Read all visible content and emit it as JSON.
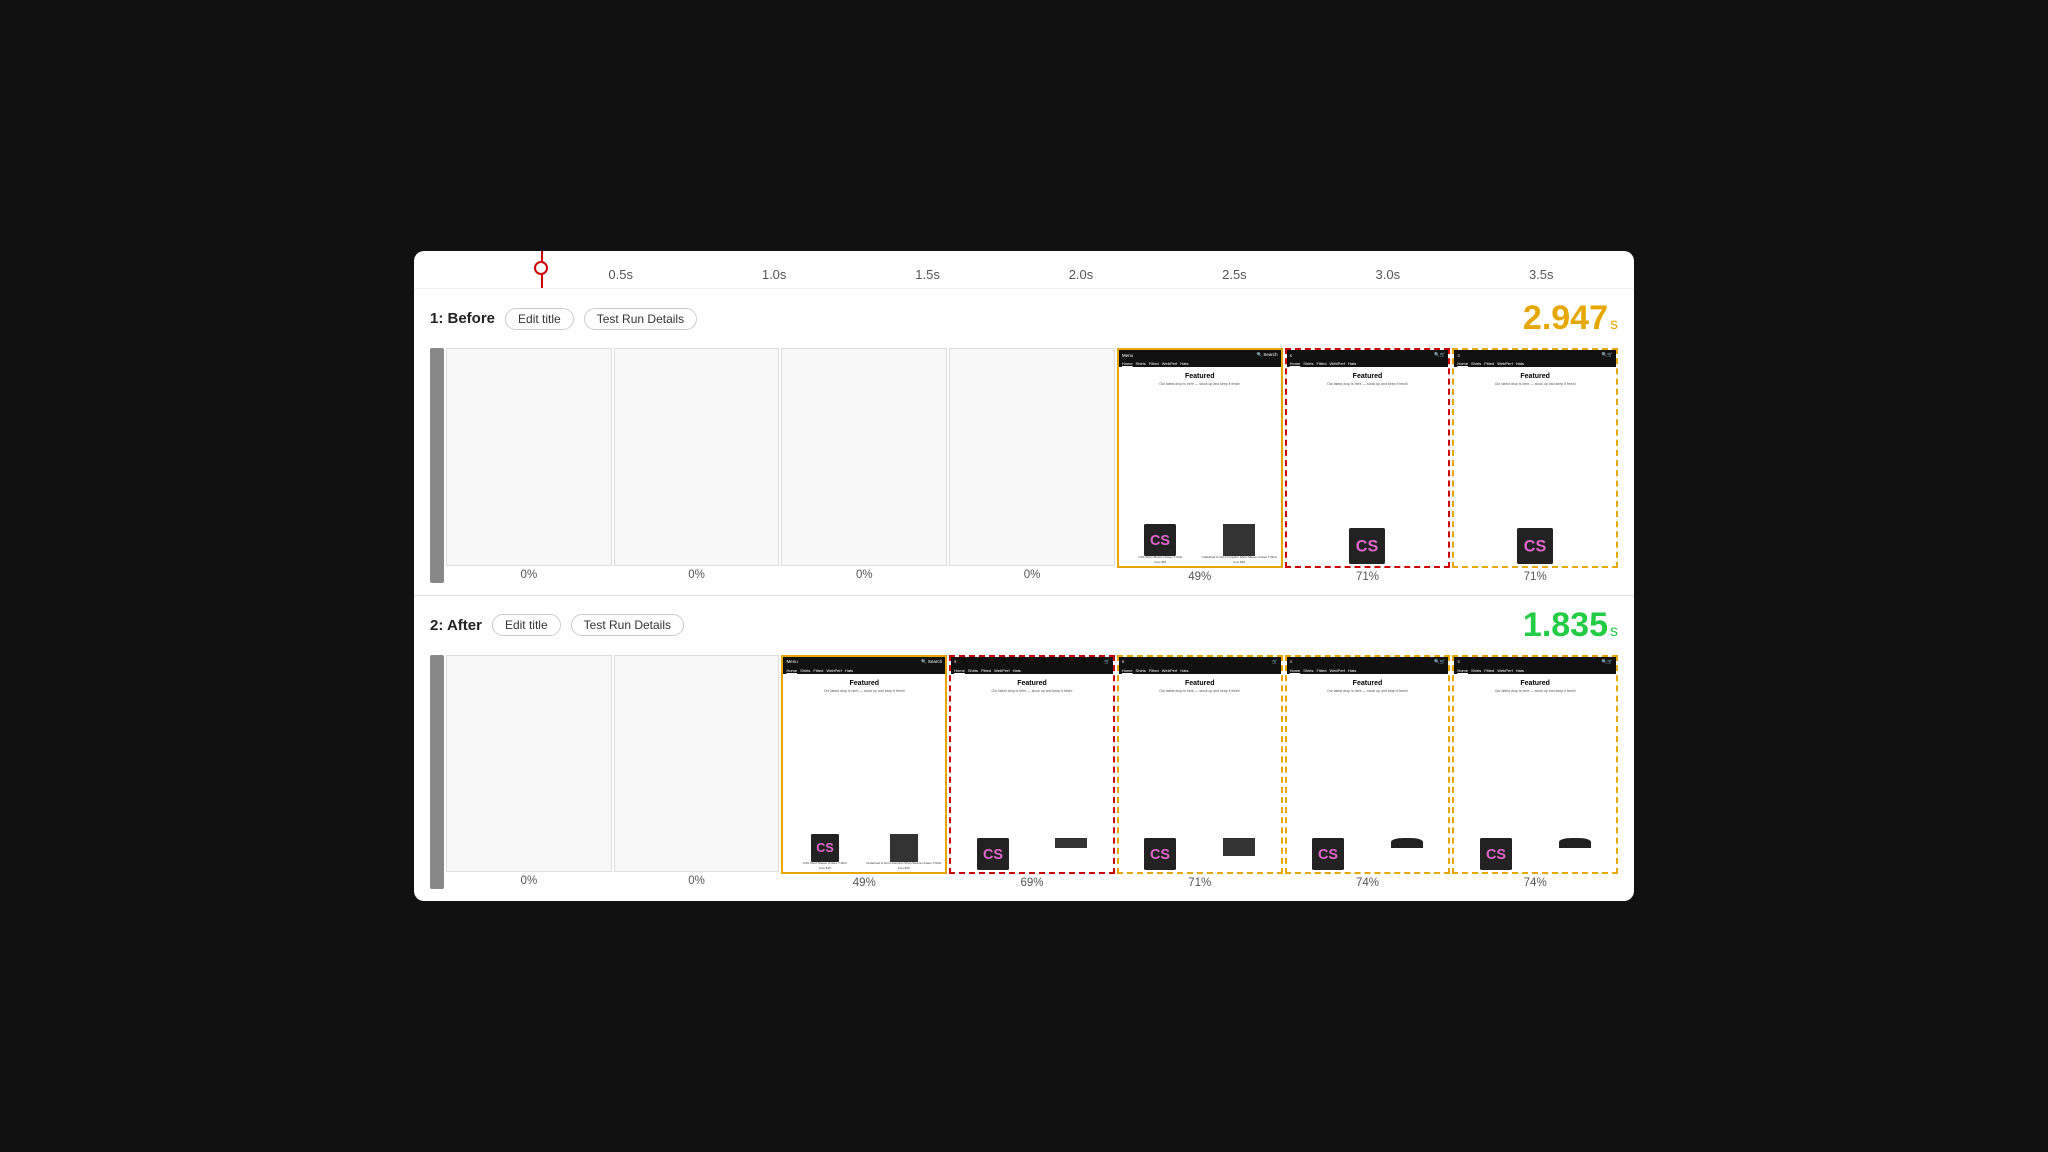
{
  "timeline": {
    "markers": [
      "0.5s",
      "1.0s",
      "1.5s",
      "2.0s",
      "2.5s",
      "3.0s",
      "3.5s"
    ]
  },
  "before": {
    "label": "1: Before",
    "edit_title_label": "Edit title",
    "test_run_label": "Test Run Details",
    "score": "2.947",
    "score_unit": "s",
    "frames": [
      {
        "pct": "0%",
        "type": "empty"
      },
      {
        "pct": "0%",
        "type": "empty"
      },
      {
        "pct": "0%",
        "type": "empty"
      },
      {
        "pct": "0%",
        "type": "empty"
      },
      {
        "pct": "49%",
        "type": "content",
        "border": "orange"
      },
      {
        "pct": "71%",
        "type": "content",
        "border": "red-dashed"
      },
      {
        "pct": "71%",
        "type": "content",
        "border": "orange-dashed"
      }
    ]
  },
  "after": {
    "label": "2: After",
    "edit_title_label": "Edit title",
    "test_run_label": "Test Run Details",
    "score": "1.835",
    "score_unit": "s",
    "frames": [
      {
        "pct": "0%",
        "type": "empty"
      },
      {
        "pct": "0%",
        "type": "empty"
      },
      {
        "pct": "49%",
        "type": "content",
        "border": "orange"
      },
      {
        "pct": "69%",
        "type": "content",
        "border": "red-dashed"
      },
      {
        "pct": "71%",
        "type": "content",
        "border": "orange-dashed"
      },
      {
        "pct": "74%",
        "type": "content",
        "border": "orange-dashed"
      },
      {
        "pct": "74%",
        "type": "content",
        "border": "orange-dashed"
      }
    ]
  },
  "nav_links": [
    "Home",
    "Shirts",
    "Fitted",
    "WebPerf",
    "Hats"
  ],
  "product1_name": "CSS Short-Sleeve Unisex T-Shirt",
  "product1_price": "from $15",
  "product2_name": "Undefined Is Not A Function Short-Sleeve Unisex T-Shirt",
  "product2_price": "from $15",
  "featured_text": "Featured",
  "featured_sub": "Our latest drop is here — stock up and keep it fresh!"
}
